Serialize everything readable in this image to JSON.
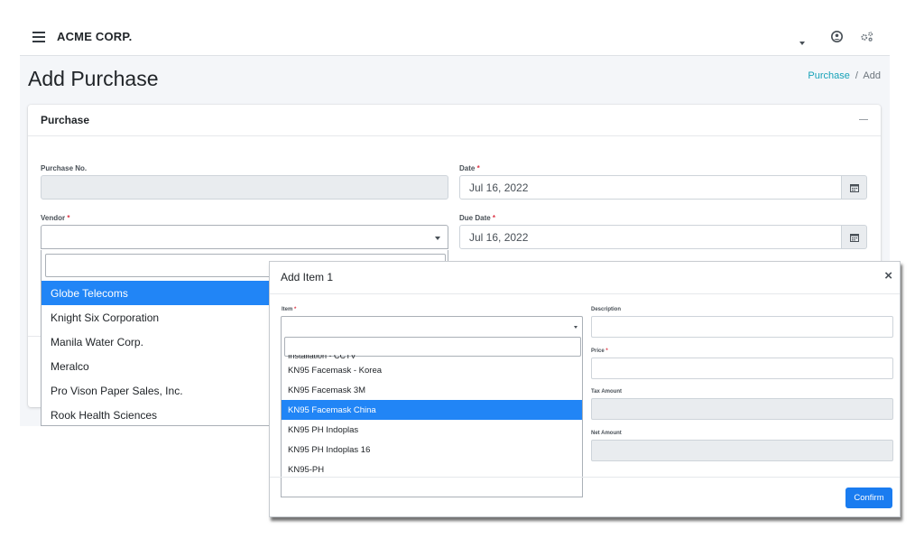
{
  "app": {
    "brand": "ACME CORP.",
    "page_title": "Add Purchase",
    "breadcrumb": {
      "link": "Purchase",
      "separator": "/",
      "current": "Add"
    }
  },
  "card": {
    "title": "Purchase",
    "purchase_no": {
      "label": "Purchase No.",
      "value": ""
    },
    "date": {
      "label": "Date",
      "value": "Jul 16, 2022"
    },
    "vendor": {
      "label": "Vendor",
      "value": ""
    },
    "due_date": {
      "label": "Due Date",
      "value": "Jul 16, 2022"
    },
    "required_mark": "*"
  },
  "vendor_dropdown": {
    "search_value": "",
    "options": [
      {
        "label": "Globe Telecoms",
        "selected": true
      },
      {
        "label": "Knight Six Corporation",
        "selected": false
      },
      {
        "label": "Manila Water Corp.",
        "selected": false
      },
      {
        "label": "Meralco",
        "selected": false
      },
      {
        "label": "Pro Vison Paper Sales, Inc.",
        "selected": false
      },
      {
        "label": "Rook Health Sciences",
        "selected": false
      }
    ]
  },
  "modal": {
    "title": "Add Item 1",
    "close_glyph": "×",
    "item": {
      "label": "Item",
      "value": ""
    },
    "description": {
      "label": "Description",
      "value": ""
    },
    "price": {
      "label": "Price",
      "value": ""
    },
    "tax_amount": {
      "label": "Tax Amount",
      "value": ""
    },
    "net_amount": {
      "label": "Net Amount",
      "value": ""
    },
    "confirm_label": "Confirm",
    "item_dropdown": {
      "search_value": "",
      "clipped_option": "Installation - CCTV",
      "options": [
        {
          "label": "KN95 Facemask - Korea",
          "selected": false
        },
        {
          "label": "KN95 Facemask 3M",
          "selected": false
        },
        {
          "label": "KN95 Facemask China",
          "selected": true
        },
        {
          "label": "KN95 PH Indoplas",
          "selected": false
        },
        {
          "label": "KN95 PH Indoplas 16",
          "selected": false
        },
        {
          "label": "KN95-PH",
          "selected": false
        }
      ]
    }
  },
  "icons": {
    "menu": "hamburger-icon",
    "dropdown": "caret-down-icon",
    "user": "user-circle-icon",
    "settings": "cogs-icon",
    "calendar": "calendar-icon"
  },
  "colors": {
    "accent": "#2185f6",
    "link": "#17a2b8",
    "required": "#dc3545",
    "readonly_bg": "#e9ecef"
  }
}
